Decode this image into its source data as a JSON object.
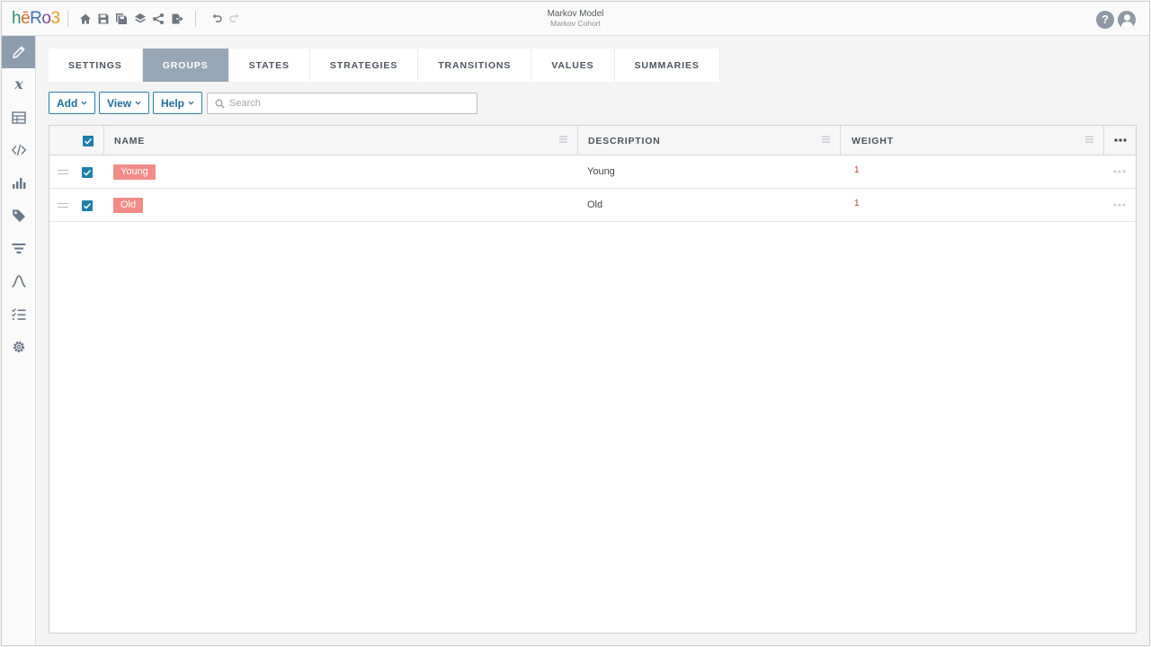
{
  "app": {
    "logo_parts": [
      "h",
      "ē",
      "R",
      "o",
      "3"
    ],
    "title": "Markov Model",
    "subtitle": "Markov Cohort",
    "help_symbol": "?"
  },
  "toolbar_icons": [
    "home-icon",
    "save-icon",
    "save-as-icon",
    "layers-icon",
    "share-icon",
    "export-icon",
    "undo-icon",
    "redo-icon"
  ],
  "nav_items": [
    "pencil-icon",
    "variable-icon",
    "table-icon",
    "code-icon",
    "bar-chart-icon",
    "tag-icon",
    "filter-icon",
    "distribution-icon",
    "checklist-icon",
    "gear-icon"
  ],
  "tabs": [
    {
      "label": "SETTINGS",
      "active": false
    },
    {
      "label": "GROUPS",
      "active": true
    },
    {
      "label": "STATES",
      "active": false
    },
    {
      "label": "STRATEGIES",
      "active": false
    },
    {
      "label": "TRANSITIONS",
      "active": false
    },
    {
      "label": "VALUES",
      "active": false
    },
    {
      "label": "SUMMARIES",
      "active": false
    }
  ],
  "actions": {
    "add_label": "Add",
    "view_label": "View",
    "help_label": "Help",
    "search_placeholder": "Search",
    "search_value": ""
  },
  "grid": {
    "columns": {
      "name": "NAME",
      "description": "DESCRIPTION",
      "weight": "WEIGHT"
    },
    "all_selected": true,
    "rows": [
      {
        "name": "Young",
        "description": "Young",
        "weight": "1",
        "selected": true
      },
      {
        "name": "Old",
        "description": "Old",
        "weight": "1",
        "selected": true
      }
    ]
  },
  "colors": {
    "accent": "#1f7fa8",
    "active_tab": "#97a6b7",
    "active_nav": "#8d9db0",
    "name_badge": "#f28b86",
    "weight_text": "#c0392b"
  }
}
